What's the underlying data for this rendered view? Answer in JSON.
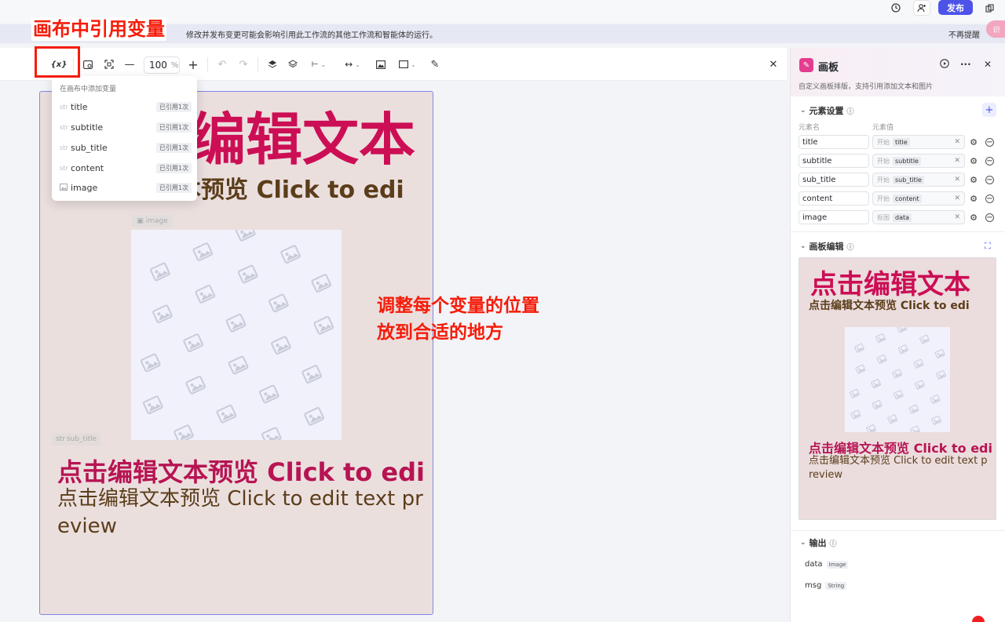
{
  "header": {
    "publish_label": "发布",
    "icons": [
      "history-icon",
      "user-add-icon",
      "copy-icon"
    ]
  },
  "notice": {
    "text": "修改并发布变更可能会影响引用此工作流的其他工作流和智能体的运行。",
    "dismiss": "不再提醒",
    "avatar_text": "识"
  },
  "annotations": {
    "title": "画布中引用变量",
    "mid_line1": "调整每个变量的位置",
    "mid_line2": "放到合适的地方"
  },
  "toolbar": {
    "variable_label": "{x}",
    "zoom_value": "100",
    "zoom_unit": "%"
  },
  "dropdown": {
    "heading": "在画布中添加变量",
    "items": [
      {
        "type": "str",
        "label": "title",
        "badge": "已引用1次"
      },
      {
        "type": "str",
        "label": "subtitle",
        "badge": "已引用1次"
      },
      {
        "type": "str",
        "label": "sub_title",
        "badge": "已引用1次"
      },
      {
        "type": "str",
        "label": "content",
        "badge": "已引用1次"
      },
      {
        "type": "img",
        "label": "image",
        "badge": "已引用1次"
      }
    ]
  },
  "poster": {
    "big_title": "编辑文本",
    "subtitle_top": "本预览 Click to edi",
    "image_tag": "image",
    "subtitle_tag": "sub_title",
    "sub_line": "点击编辑文本预览 Click to edi",
    "content": "点击编辑文本预览 Click to edit text preview"
  },
  "panel": {
    "title": "画板",
    "description": "自定义画板排版，支持引用添加文本和图片",
    "section_elements": "元素设置",
    "col_name": "元素名",
    "col_value": "元素值",
    "rows": [
      {
        "name": "title",
        "prefix": "开始",
        "value": "title"
      },
      {
        "name": "subtitle",
        "prefix": "开始",
        "value": "subtitle"
      },
      {
        "name": "sub_title",
        "prefix": "开始",
        "value": "sub_title"
      },
      {
        "name": "content",
        "prefix": "开始",
        "value": "content"
      },
      {
        "name": "image",
        "prefix": "抠图",
        "value": "data"
      }
    ],
    "section_canvas": "画板编辑",
    "preview": {
      "title": "点击编辑文本",
      "sub": "点击编辑文本预览 Click to edi",
      "sub2": "点击编辑文本预览 Click to edi",
      "content": "点击编辑文本预览 Click to edit text preview"
    },
    "section_output": "输出",
    "outputs": [
      {
        "name": "data",
        "type": "Image"
      },
      {
        "name": "msg",
        "type": "String"
      }
    ]
  },
  "colors": {
    "accent": "#4d53e8",
    "annotation_red": "#f51c0a",
    "title_pink": "#cc0e55",
    "brown": "#5b3d1a",
    "poster_bg": "#ebdfde"
  }
}
